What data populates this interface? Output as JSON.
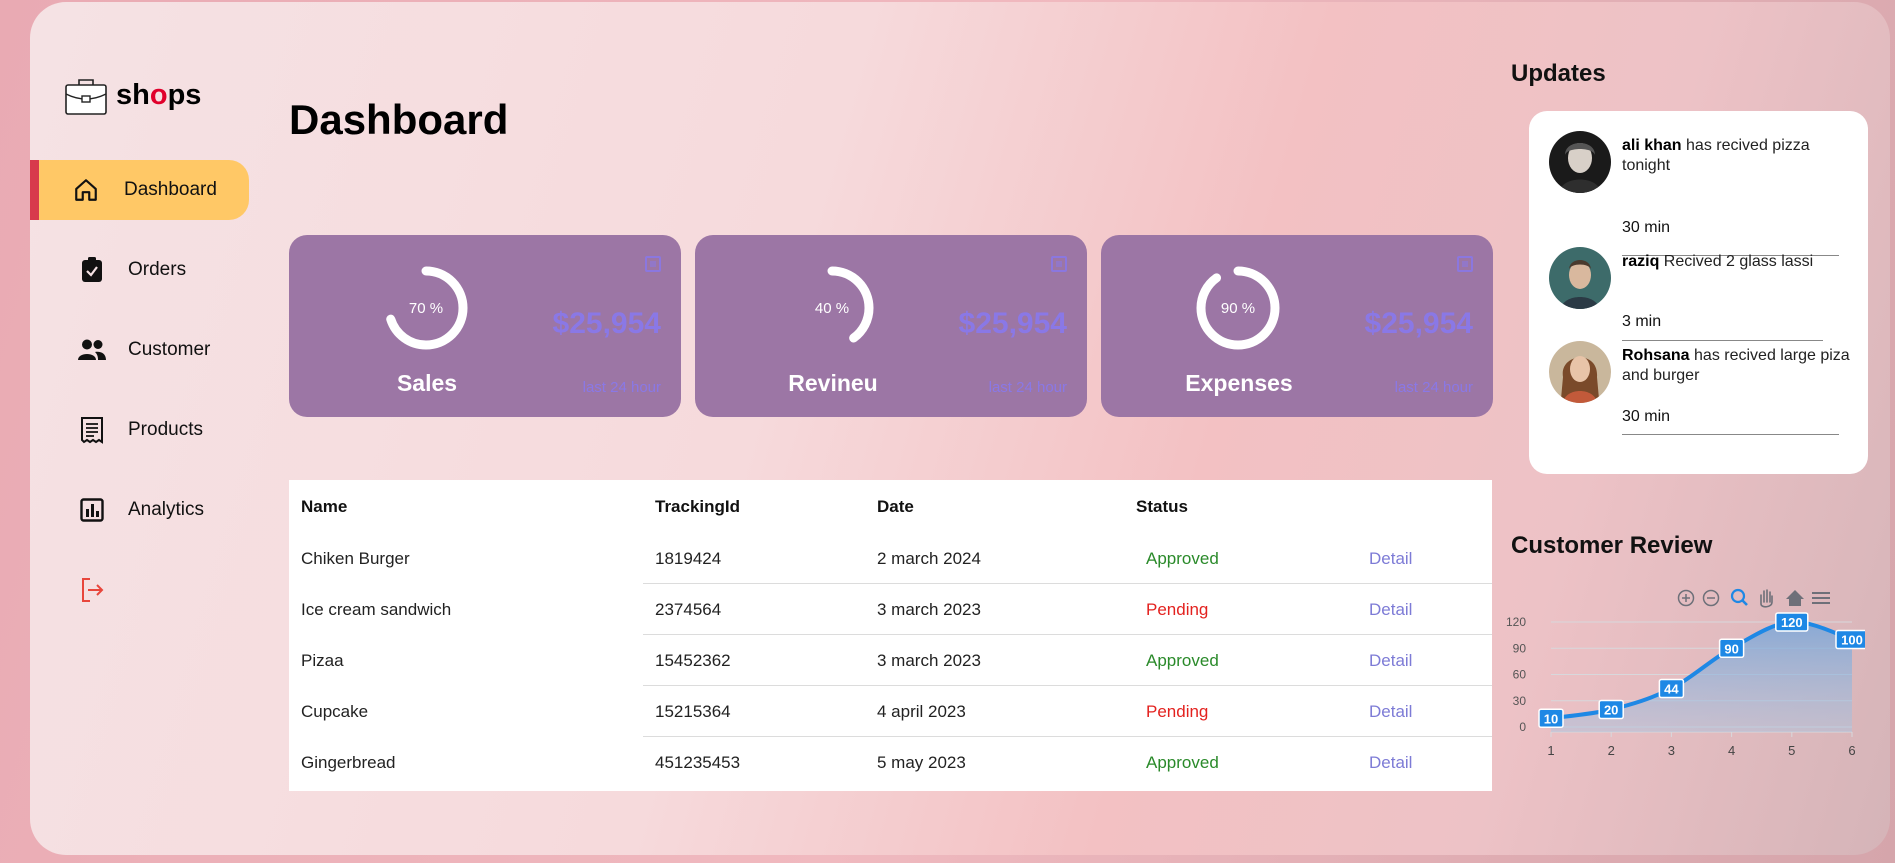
{
  "brand": {
    "name_prefix": "sh",
    "name_accent": "o",
    "name_suffix": "ps"
  },
  "sidebar": {
    "items": [
      {
        "label": "Dashboard",
        "icon": "home-icon",
        "active": true
      },
      {
        "label": "Orders",
        "icon": "clipboard-icon",
        "active": false
      },
      {
        "label": "Customer",
        "icon": "users-icon",
        "active": false
      },
      {
        "label": "Products",
        "icon": "receipt-icon",
        "active": false
      },
      {
        "label": "Analytics",
        "icon": "chart-icon",
        "active": false
      }
    ],
    "logout_icon": "logout-icon"
  },
  "page": {
    "title": "Dashboard"
  },
  "cards": [
    {
      "title": "Sales",
      "percent": 70,
      "percent_label": "70 %",
      "amount": "$25,954",
      "sub": "last 24 hour"
    },
    {
      "title": "Revineu",
      "percent": 40,
      "percent_label": "40 %",
      "amount": "$25,954",
      "sub": "last 24 hour"
    },
    {
      "title": "Expenses",
      "percent": 90,
      "percent_label": "90 %",
      "amount": "$25,954",
      "sub": "last 24 hour"
    }
  ],
  "table": {
    "headers": {
      "name": "Name",
      "tracking": "TrackingId",
      "date": "Date",
      "status": "Status"
    },
    "rows": [
      {
        "name": "Chiken Burger",
        "tracking": "1819424",
        "date": "2 march 2024",
        "status": "Approved",
        "action": "Detail"
      },
      {
        "name": "Ice cream sandwich",
        "tracking": "2374564",
        "date": "3 march 2023",
        "status": "Pending",
        "action": "Detail"
      },
      {
        "name": "Pizaa",
        "tracking": "15452362",
        "date": "3 march 2023",
        "status": "Approved",
        "action": "Detail"
      },
      {
        "name": "Cupcake",
        "tracking": "15215364",
        "date": "4 april 2023",
        "status": "Pending",
        "action": "Detail"
      },
      {
        "name": "Gingerbread",
        "tracking": "451235453",
        "date": "5 may 2023",
        "status": "Approved",
        "action": "Detail"
      }
    ]
  },
  "updates": {
    "title": "Updates",
    "items": [
      {
        "name": "ali khan",
        "text": "has recived pizza tonight",
        "time": "30 min"
      },
      {
        "name": "raziq",
        "text": "Recived 2 glass lassi",
        "time": "3 min"
      },
      {
        "name": "Rohsana",
        "text": "has recived large piza and burger",
        "time": "30 min"
      }
    ]
  },
  "review": {
    "title": "Customer Review",
    "toolbar": [
      "zoom-in-icon",
      "zoom-out-icon",
      "zoom-select-icon",
      "pan-hand-icon",
      "home-reset-icon",
      "menu-icon"
    ]
  },
  "chart_data": {
    "type": "area",
    "x": [
      1,
      2,
      3,
      4,
      5,
      6
    ],
    "values": [
      10,
      20,
      44,
      90,
      120,
      100
    ],
    "xlabel": "",
    "ylabel": "",
    "ylim": [
      0,
      120
    ],
    "yticks": [
      0,
      30,
      60,
      90,
      120
    ],
    "grid": true,
    "colors": {
      "line": "#1e88e5",
      "fill": "#8eb4dc",
      "label_bg": "#1e88e5"
    }
  },
  "colors": {
    "card_bg": "#9c76a5",
    "accent": "#ffc866",
    "active_bar": "#d83a4c",
    "approved": "#2a8a2a",
    "pending": "#e3221f",
    "link": "#7d7bd6"
  }
}
